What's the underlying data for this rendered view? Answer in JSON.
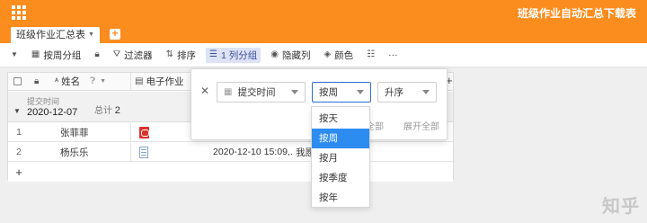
{
  "app": {
    "title": "班级作业自动汇总下载表"
  },
  "tab": {
    "label": "班级作业汇总表"
  },
  "toolbar": {
    "group_by": "按周分组",
    "filter": "过滤器",
    "sort": "排序",
    "group": "1 列分组",
    "hide": "隐藏列",
    "color": "颜色",
    "more": "···"
  },
  "table": {
    "columns": [
      "姓名",
      "电子作业"
    ],
    "group": {
      "label": "提交时间",
      "date": "2020-12-07",
      "total_label": "总计",
      "total": "2"
    },
    "rows": [
      {
        "index": "1",
        "name": "张菲菲",
        "file_type": "pdf",
        "time": "",
        "extra": ""
      },
      {
        "index": "2",
        "name": "杨乐乐",
        "file_type": "doc",
        "time": "2020-12-10 15:09,...",
        "extra": "我愿"
      }
    ],
    "add": "+"
  },
  "panel": {
    "field": "提交时间",
    "period": "按周",
    "order": "升序",
    "collapse_all": "收起全部",
    "expand_all": "展开全部"
  },
  "dropdown": {
    "options": [
      "按天",
      "按周",
      "按月",
      "按季度",
      "按年"
    ],
    "selected": "按周"
  },
  "watermark": "知乎"
}
